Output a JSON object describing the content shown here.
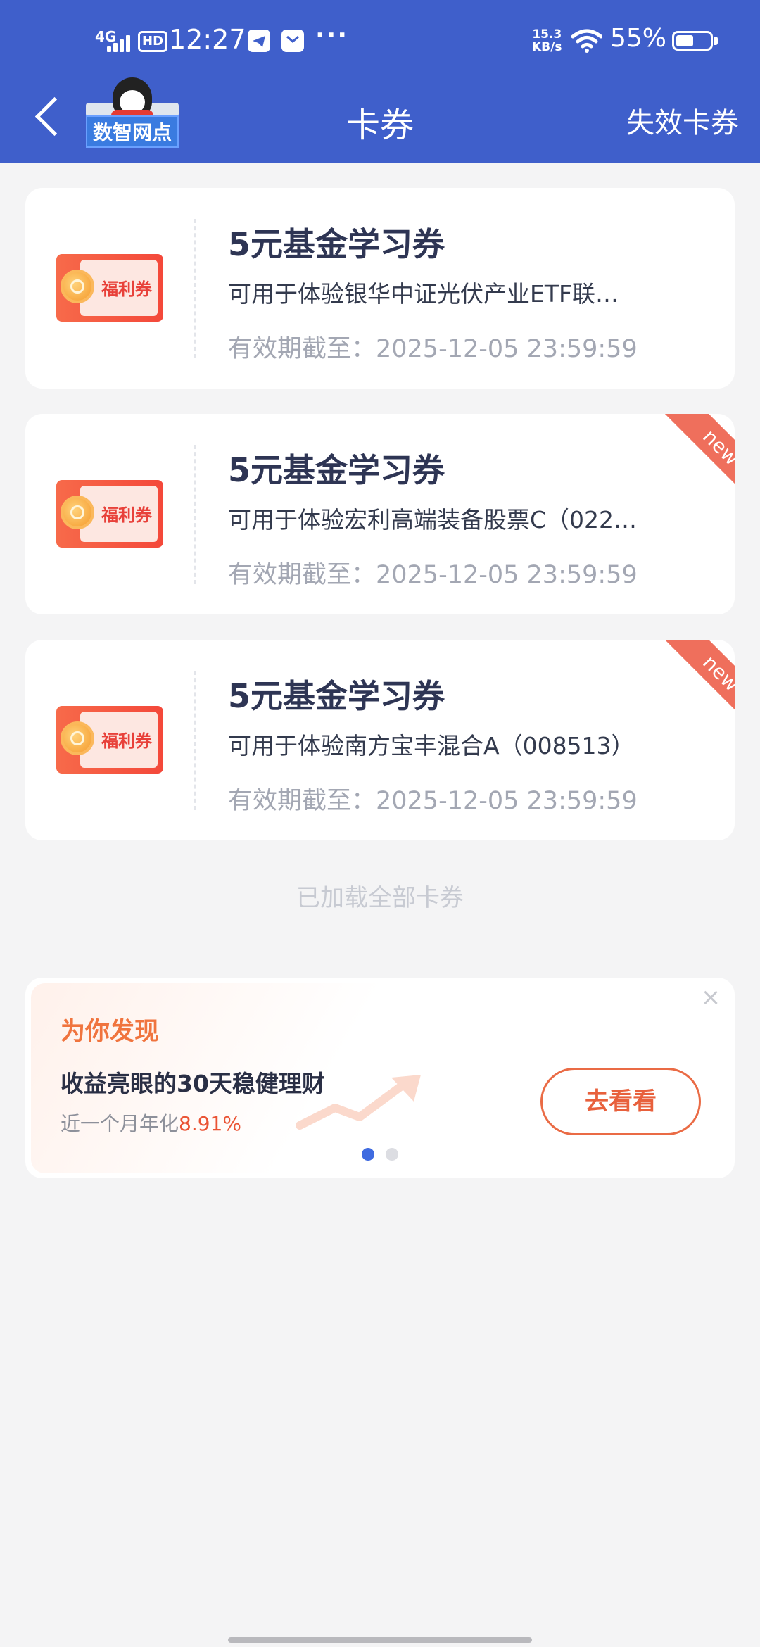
{
  "status_bar": {
    "network": "4G",
    "hd": "HD",
    "time": "12:27",
    "more": "···",
    "speed_value": "15.3",
    "speed_unit": "KB/s",
    "battery": "55%"
  },
  "nav": {
    "logo_text": "数智网点",
    "title": "卡券",
    "right_link": "失效卡券"
  },
  "coupons": [
    {
      "image_label": "福利券",
      "title": "5元基金学习券",
      "description": "可用于体验银华中证光伏产业ETF联…",
      "expiry": "有效期截至：2025-12-05 23:59:59",
      "badge": ""
    },
    {
      "image_label": "福利券",
      "title": "5元基金学习券",
      "description": "可用于体验宏利高端装备股票C（022…",
      "expiry": "有效期截至：2025-12-05 23:59:59",
      "badge": "new"
    },
    {
      "image_label": "福利券",
      "title": "5元基金学习券",
      "description": "可用于体验南方宝丰混合A（008513）",
      "expiry": "有效期截至：2025-12-05 23:59:59",
      "badge": "new"
    }
  ],
  "loaded_text": "已加载全部卡券",
  "promo": {
    "tag": "为你发现",
    "title": "收益亮眼的30天稳健理财",
    "sub_prefix": "近一个月年化",
    "sub_value": "8.91%",
    "button": "去看看",
    "close": "×",
    "carousel_active": 1,
    "carousel_total": 2
  },
  "colors": {
    "header_bg": "#3f5fcb",
    "accent_orange": "#ea6b45",
    "ribbon": "#ef6f5c",
    "dot_active": "#3f6be0",
    "dot_inactive": "#dcdde2"
  }
}
